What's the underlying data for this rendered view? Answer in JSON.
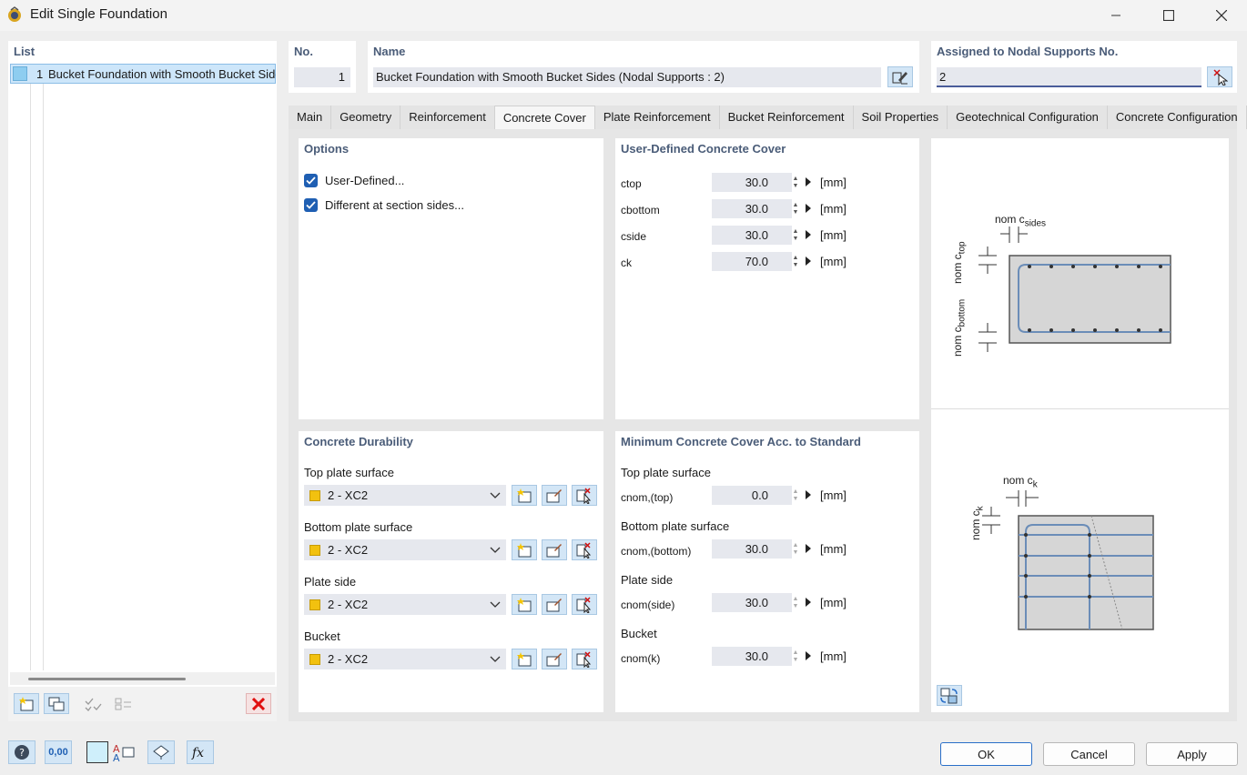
{
  "window": {
    "title": "Edit Single Foundation",
    "minimize_icon": "minimize-icon",
    "maximize_icon": "maximize-icon",
    "close_icon": "close-icon"
  },
  "list": {
    "header": "List",
    "items": [
      {
        "number": "1",
        "label": "Bucket Foundation with Smooth Bucket Sides",
        "color": "#8ecdf0"
      }
    ]
  },
  "header": {
    "no_label": "No.",
    "no_value": "1",
    "name_label": "Name",
    "name_value": "Bucket Foundation with Smooth Bucket Sides (Nodal Supports : 2)",
    "assigned_label": "Assigned to Nodal Supports No.",
    "assigned_value": "2"
  },
  "tabs": [
    {
      "label": "Main",
      "active": false
    },
    {
      "label": "Geometry",
      "active": false
    },
    {
      "label": "Reinforcement",
      "active": false
    },
    {
      "label": "Concrete Cover",
      "active": true
    },
    {
      "label": "Plate Reinforcement",
      "active": false
    },
    {
      "label": "Bucket Reinforcement",
      "active": false
    },
    {
      "label": "Soil Properties",
      "active": false
    },
    {
      "label": "Geotechnical Configuration",
      "active": false
    },
    {
      "label": "Concrete Configuration",
      "active": false
    }
  ],
  "options": {
    "title": "Options",
    "user_defined": "User-Defined...",
    "different_sides": "Different at section sides..."
  },
  "user_cover": {
    "title": "User-Defined Concrete Cover",
    "unit": "[mm]",
    "rows": [
      {
        "label": "ctop",
        "value": "30.0"
      },
      {
        "label": "cbottom",
        "value": "30.0"
      },
      {
        "label": "cside",
        "value": "30.0"
      },
      {
        "label": "ck",
        "value": "70.0"
      }
    ]
  },
  "durability": {
    "title": "Concrete Durability",
    "rows": [
      {
        "label": "Top plate surface",
        "value": "2 - XC2"
      },
      {
        "label": "Bottom plate surface",
        "value": "2 - XC2"
      },
      {
        "label": "Plate side",
        "value": "2 - XC2"
      },
      {
        "label": "Bucket",
        "value": "2 - XC2"
      }
    ]
  },
  "min_cover": {
    "title": "Minimum Concrete Cover Acc. to Standard",
    "unit": "[mm]",
    "rows": [
      {
        "label": "Top plate surface",
        "symbol": "cnom,(top)",
        "value": "0.0"
      },
      {
        "label": "Bottom plate surface",
        "symbol": "cnom,(bottom)",
        "value": "30.0"
      },
      {
        "label": "Plate side",
        "symbol": "cnom(side)",
        "value": "30.0"
      },
      {
        "label": "Bucket",
        "symbol": "cnom(k)",
        "value": "30.0"
      }
    ]
  },
  "diagram": {
    "label_sides_main": "nom c",
    "label_sides_sub": "sides",
    "label_top_main": "nom c",
    "label_top_sub": "top",
    "label_bottom_main": "nom c",
    "label_bottom_sub": "bottom",
    "label_k_main": "nom c",
    "label_k_sub": "k"
  },
  "buttons": {
    "ok": "OK",
    "cancel": "Cancel",
    "apply": "Apply"
  },
  "bottom_toolbar": {
    "units_value": "0,00"
  }
}
